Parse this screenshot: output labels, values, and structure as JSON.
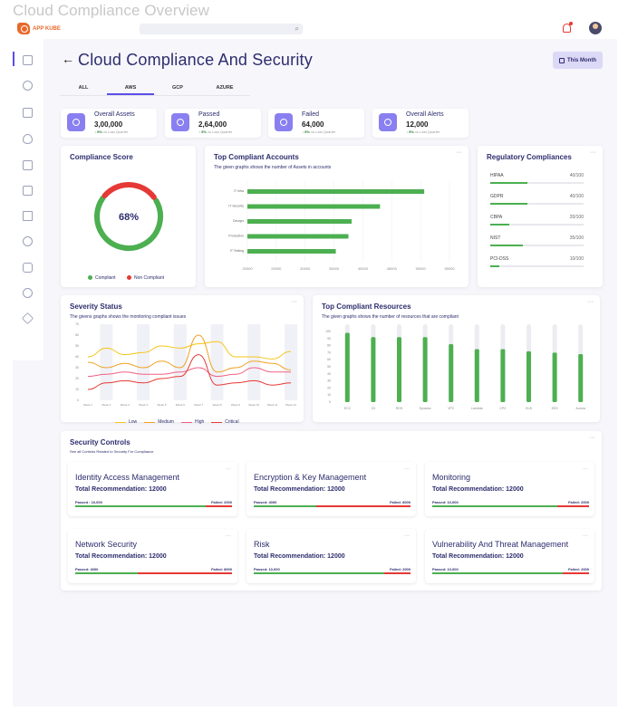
{
  "frame_title": "Cloud Compliance Overview",
  "brand": {
    "name": "APP KUBE",
    "accent": "#e8692c"
  },
  "header": {
    "search_placeholder": "",
    "notify_color": "#e53935"
  },
  "page": {
    "back": "←",
    "title": "Cloud Compliance And Security",
    "range_button": "This Month"
  },
  "tabs": [
    {
      "label": "ALL"
    },
    {
      "label": "AWS",
      "active": true
    },
    {
      "label": "GCP"
    },
    {
      "label": "AZURE"
    }
  ],
  "stats": [
    {
      "label": "Overall  Assets",
      "value": "3,00,000",
      "trend": "5%",
      "trend_text": "vs Last Quarter"
    },
    {
      "label": "Passed",
      "value": "2,64,000",
      "trend": "5%",
      "trend_text": "vs Last Quarter"
    },
    {
      "label": "Failed",
      "value": "64,000",
      "trend": "5%",
      "trend_text": "vs Last Quarter"
    },
    {
      "label": "Overall Alerts",
      "value": "12,000",
      "trend": "5%",
      "trend_text": "vs Last Quarter"
    }
  ],
  "compliance_score": {
    "title": "Compliance Score",
    "value_label": "68%",
    "legend": [
      {
        "label": "Compliant",
        "color": "#4caf50"
      },
      {
        "label": "Non Compliant",
        "color": "#e53935"
      }
    ]
  },
  "regulatory": {
    "title": "Regulatory Compliances",
    "items": [
      {
        "name": "HIPAA",
        "value": "40/100",
        "fraction": 0.4
      },
      {
        "name": "GDPR",
        "value": "40/100",
        "fraction": 0.4
      },
      {
        "name": "CBPA",
        "value": "20/100",
        "fraction": 0.2
      },
      {
        "name": "NIST",
        "value": "35/100",
        "fraction": 0.35
      },
      {
        "name": "PCI-DSS",
        "value": "10/100",
        "fraction": 0.1
      }
    ]
  },
  "icons": {
    "sidebar": [
      "grid-icon",
      "cloud-icon",
      "list-icon",
      "shield-icon",
      "table-icon",
      "chip-icon",
      "bank-icon",
      "doc-icon",
      "chat-icon",
      "settings-icon",
      "layers-icon"
    ]
  },
  "chart_data": [
    {
      "id": "top_compliant_accounts",
      "type": "bar",
      "title": "Top Compliant Accounts",
      "subtitle": "The given graphs shows the number of Assets  in accounts",
      "orientation": "horizontal",
      "categories": [
        "IT Infra",
        "IT Security",
        "Devops",
        "Production",
        "IT Testing"
      ],
      "values": [
        48000,
        41000,
        36500,
        36000,
        34000
      ],
      "xlim": [
        20000,
        52000
      ],
      "x_ticks": [
        "20000",
        "25000",
        "30000",
        "35000",
        "40000",
        "45000",
        "50000",
        "55000"
      ],
      "color": "#4caf50"
    },
    {
      "id": "severity_status",
      "type": "line",
      "title": "Severity Status",
      "subtitle": "The givens graphs shows the  monitoring compliant issues",
      "categories": [
        "Week 1",
        "Week 2",
        "Week 3",
        "Week 4",
        "Week 5",
        "Week 6",
        "Week 7",
        "Week 8",
        "Week 9",
        "Week 10",
        "Week 11",
        "Week 12"
      ],
      "y_ticks": [
        "0",
        "10",
        "20",
        "30",
        "40",
        "50",
        "60",
        "70"
      ],
      "ylim": [
        0,
        70
      ],
      "series": [
        {
          "name": "Low",
          "color": "#f5c518",
          "values": [
            40,
            48,
            42,
            44,
            50,
            48,
            52,
            54,
            40,
            40,
            38,
            45
          ]
        },
        {
          "name": "Medium",
          "color": "#f0a020",
          "values": [
            35,
            30,
            34,
            30,
            36,
            30,
            60,
            26,
            30,
            36,
            34,
            28
          ]
        },
        {
          "name": "High",
          "color": "#f06080",
          "values": [
            22,
            24,
            26,
            24,
            24,
            26,
            30,
            22,
            24,
            30,
            26,
            26
          ]
        },
        {
          "name": "Critical",
          "color": "#e53935",
          "values": [
            10,
            16,
            18,
            16,
            20,
            22,
            42,
            14,
            16,
            18,
            14,
            16
          ]
        }
      ]
    },
    {
      "id": "top_compliant_resources",
      "type": "bar",
      "title": "Top Compliant Resources",
      "subtitle": "The given graphs shows the number of resources that are compliant",
      "categories": [
        "EC2",
        "S3",
        "RDS",
        "Dynamo",
        "VPC",
        "Lambda",
        "CPC",
        "ELB",
        "EKS",
        "Aurora"
      ],
      "values": [
        98,
        92,
        92,
        92,
        82,
        75,
        75,
        72,
        70,
        68
      ],
      "ylim": [
        0,
        100
      ],
      "y_ticks": [
        "0",
        "10",
        "20",
        "30",
        "40",
        "50",
        "60",
        "70",
        "80",
        "90",
        "100"
      ],
      "color": "#4caf50"
    }
  ],
  "security_controls": {
    "title": "Security Controls",
    "subtitle": "See all Controls Related to Security For Compliance",
    "cards": [
      {
        "title": "Identity Access Management",
        "rec": "Total  Recommendation:  12000",
        "passed": "Passed : 10,000",
        "failed": "Failed: 2000",
        "pass_fraction": 0.83
      },
      {
        "title": "Encryption & Key Management",
        "rec": "Total  Recommendation:  12000",
        "passed": "Passed: 4000",
        "failed": "Failed: 8000",
        "pass_fraction": 0.4
      },
      {
        "title": "Monitoring",
        "rec": "Total  Recommendation:  12000",
        "passed": "Passed: 10,000",
        "failed": "Failed: 2000",
        "pass_fraction": 0.8
      },
      {
        "title": "Network Security",
        "rec": "Total  Recommendation:  12000",
        "passed": "Passed: 4000",
        "failed": "Failed: 8000",
        "pass_fraction": 0.4
      },
      {
        "title": "Risk",
        "rec": "Total  Recommendation:  12000",
        "passed": "Passed: 10,000",
        "failed": "Failed: 2000",
        "pass_fraction": 0.83
      },
      {
        "title": "Vulnerability And Threat Management",
        "rec": "Total  Recommendation:  12000",
        "passed": "Passed: 10,000",
        "failed": "Failed: 2000",
        "pass_fraction": 0.83
      }
    ]
  }
}
